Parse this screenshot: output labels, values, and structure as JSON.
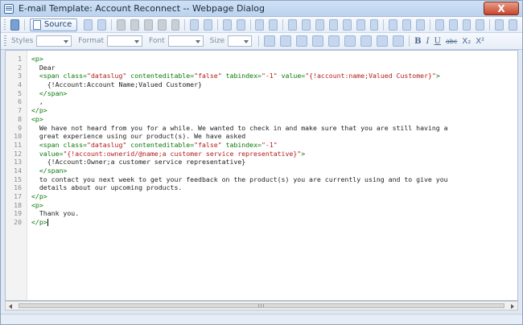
{
  "window": {
    "title": "E-mail Template: Account Reconnect -- Webpage Dialog",
    "close_label": "X"
  },
  "toolbar": {
    "source_label": "Source",
    "styles_label": "Styles",
    "format_label": "Format",
    "font_label": "Font",
    "size_label": "Size",
    "bold": "B",
    "italic": "I",
    "underline": "U",
    "strike": "abc",
    "subscript": "X₂",
    "superscript": "X²"
  },
  "editor": {
    "lines": [
      {
        "n": "1",
        "html": "<span class='tag'>&lt;p&gt;</span>"
      },
      {
        "n": "2",
        "html": "  Dear"
      },
      {
        "n": "3",
        "html": "  <span class='tag'>&lt;span</span> <span class='attr'>class=</span><span class='str'>\"dataslug\"</span> <span class='attr'>contenteditable=</span><span class='str'>\"false\"</span> <span class='attr'>tabindex=</span><span class='str'>\"-1\"</span> <span class='attr'>value=</span><span class='str'>\"{!account:name;Valued Customer}\"</span><span class='tag'>&gt;</span>"
      },
      {
        "n": "4",
        "html": "    {!Account:Account Name;Valued Customer}"
      },
      {
        "n": "5",
        "html": "  <span class='tag'>&lt;/span&gt;</span>"
      },
      {
        "n": "6",
        "html": "  ,"
      },
      {
        "n": "7",
        "html": "<span class='tag'>&lt;/p&gt;</span>"
      },
      {
        "n": "8",
        "html": "<span class='tag'>&lt;p&gt;</span>"
      },
      {
        "n": "9",
        "html": "  We have not heard from you for a while. We wanted to check in and make sure that you are still having a"
      },
      {
        "n": "10",
        "html": "  great experience using our product(s). We have asked"
      },
      {
        "n": "11",
        "html": "  <span class='tag'>&lt;span</span> <span class='attr'>class=</span><span class='str'>\"dataslug\"</span> <span class='attr'>contenteditable=</span><span class='str'>\"false\"</span> <span class='attr'>tabindex=</span><span class='str'>\"-1\"</span>"
      },
      {
        "n": "12",
        "html": "  <span class='attr'>value=</span><span class='str'>\"{!account:ownerid/@name;a customer service representative}\"</span><span class='tag'>&gt;</span>"
      },
      {
        "n": "13",
        "html": "    {!Account:Owner;a customer service representative}"
      },
      {
        "n": "14",
        "html": "  <span class='tag'>&lt;/span&gt;</span>"
      },
      {
        "n": "15",
        "html": "  to contact you next week to get your feedback on the product(s) you are currently using and to give you"
      },
      {
        "n": "16",
        "html": "  details about our upcoming products."
      },
      {
        "n": "17",
        "html": "<span class='tag'>&lt;/p&gt;</span>"
      },
      {
        "n": "18",
        "html": "<span class='tag'>&lt;p&gt;</span>"
      },
      {
        "n": "19",
        "html": "  Thank you."
      },
      {
        "n": "20",
        "html": "<span class='tag'>&lt;/p&gt;</span><span class='cursor'></span>"
      }
    ]
  },
  "colors": {
    "tag": "#0b7a0b",
    "string": "#b31b1b",
    "title_bar": "#bcd3ee"
  }
}
